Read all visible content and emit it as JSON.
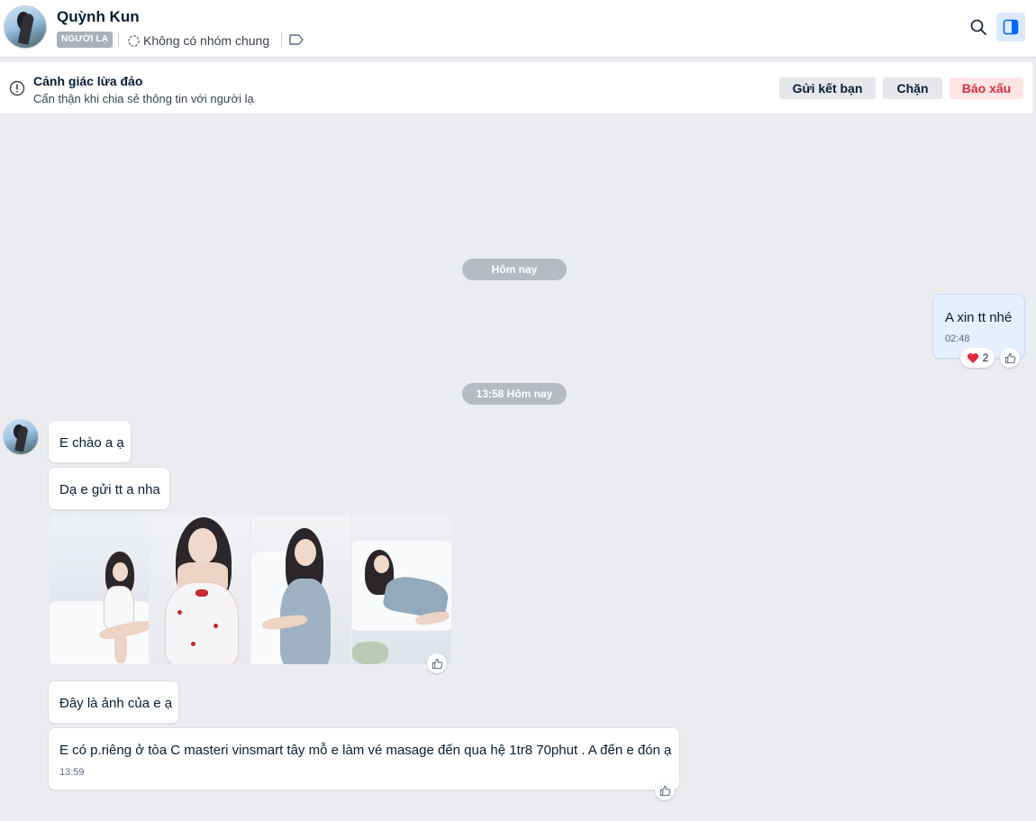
{
  "header": {
    "contact_name": "Quỳnh Kun",
    "stranger_badge": "NGƯỜI LẠ",
    "group_info": "Không có nhóm chung"
  },
  "warning": {
    "title": "Cảnh giác lừa đảo",
    "subtitle": "Cẩn thận khi chia sẻ thông tin với người lạ",
    "add_friend_label": "Gửi kết bạn",
    "block_label": "Chặn",
    "report_label": "Báo xấu"
  },
  "chat": {
    "date_separator_1": "Hôm nay",
    "date_separator_2": "13:58 Hôm nay",
    "outgoing": {
      "text": "A xin tt nhé",
      "time": "02:48",
      "reaction_count": "2"
    },
    "incoming": [
      {
        "text": "E chào a ạ"
      },
      {
        "text": "Dạ e gửi tt a nha"
      },
      {
        "text": "Đây là ảnh của e ạ"
      },
      {
        "text": "E có p.riêng ở tòa C masteri vinsmart tây mỗ e làm vé masage đến qua hệ 1tr8 70phut . A đến e đón ạ",
        "time": "13:59"
      }
    ]
  },
  "colors": {
    "accent": "#0068ff",
    "report": "#d92c39",
    "outgoing_bubble": "#e5efff",
    "chat_background": "#ebecf0"
  }
}
